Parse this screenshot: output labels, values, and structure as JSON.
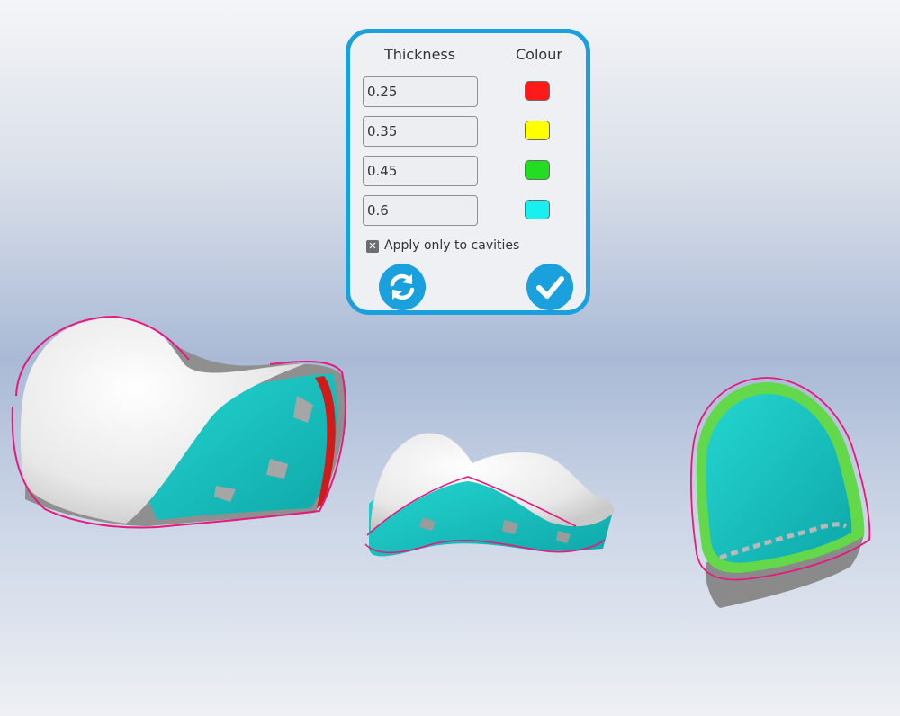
{
  "panel": {
    "thickness_header": "Thickness",
    "colour_header": "Colour",
    "rows": [
      {
        "value": "0.25",
        "colour": "#ff1a1a"
      },
      {
        "value": "0.35",
        "colour": "#ffff00"
      },
      {
        "value": "0.45",
        "colour": "#22dd22"
      },
      {
        "value": "0.6",
        "colour": "#18f0f0"
      }
    ],
    "apply_only_to_cavities_label": "Apply only to cavities",
    "apply_only_to_cavities_checked": true,
    "refresh_icon": "refresh-icon",
    "confirm_icon": "checkmark-icon"
  },
  "colors": {
    "accent": "#1aa0dc",
    "margin_line": "#e6197e",
    "surface_teal": "#19c4c4",
    "surface_white": "#f1f1f1",
    "surface_grey": "#9e9e9e"
  }
}
